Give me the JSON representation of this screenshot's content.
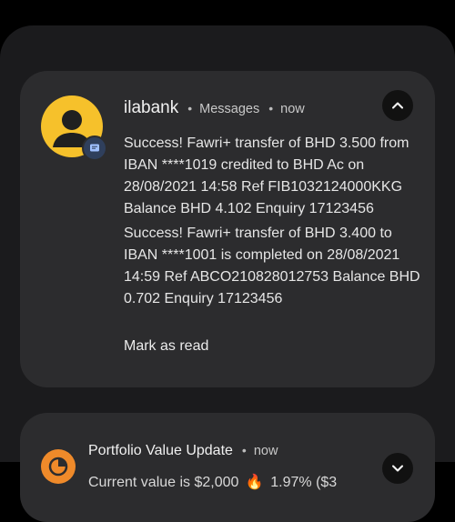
{
  "notification_1": {
    "app_name": "ilabank",
    "separator": "•",
    "category": "Messages",
    "time": "now",
    "messages": [
      "Success! Fawri+ transfer of BHD 3.500 from IBAN ****1019 credited to BHD Ac on 28/08/2021 14:58 Ref FIB1032124000KKG Balance BHD 4.102 Enquiry 17123456",
      "Success! Fawri+ transfer of BHD 3.400 to IBAN ****1001 is completed on 28/08/2021 14:59 Ref ABCO210828012753 Balance BHD 0.702 Enquiry 17123456"
    ],
    "action_label": "Mark as read",
    "icons": {
      "avatar": "person-avatar-icon",
      "badge": "message-badge-icon",
      "expand": "chevron-up-icon"
    },
    "colors": {
      "avatar_bg": "#f6c12b",
      "badge_bg": "#2f3f5c",
      "card_bg": "#2c2c2e"
    }
  },
  "notification_2": {
    "title": "Portfolio Value Update",
    "separator": "•",
    "time": "now",
    "preview_start": "Current value is $2,000",
    "preview_end": "1.97% ($3",
    "icons": {
      "avatar": "portfolio-app-icon",
      "trend": "fire-icon",
      "expand": "chevron-down-icon"
    },
    "colors": {
      "avatar_bg": "#ef8a2a"
    }
  }
}
